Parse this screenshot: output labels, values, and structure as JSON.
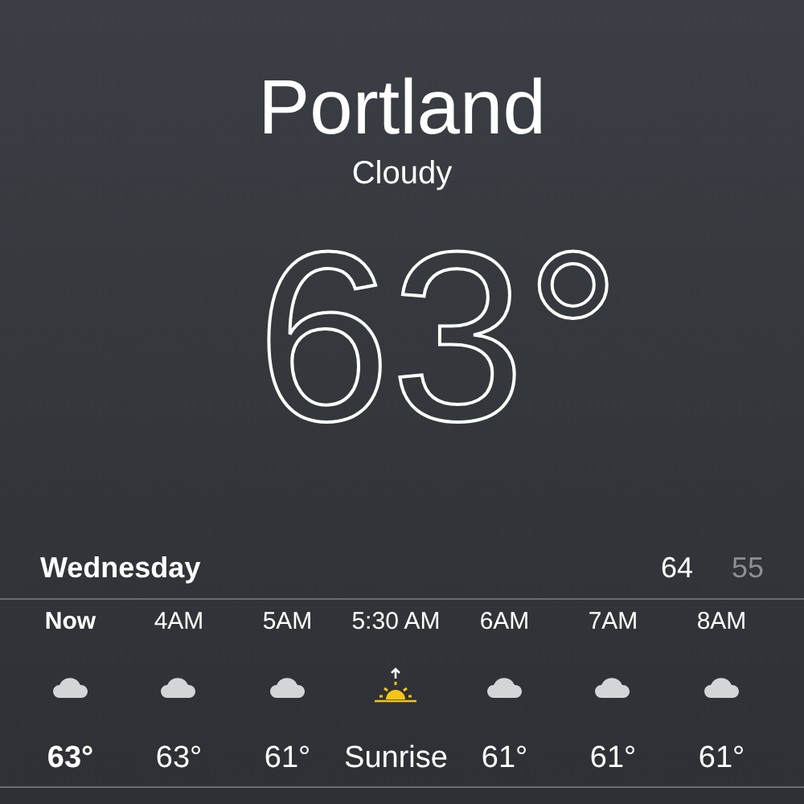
{
  "location": {
    "city": "Portland",
    "condition": "Cloudy",
    "temperature": "63°"
  },
  "today": {
    "day": "Wednesday",
    "high": "64",
    "low": "55"
  },
  "hourly": [
    {
      "time": "Now",
      "kind": "cloud",
      "value": "63°",
      "current": true
    },
    {
      "time": "4AM",
      "kind": "cloud",
      "value": "63°",
      "current": false
    },
    {
      "time": "5AM",
      "kind": "cloud",
      "value": "61°",
      "current": false
    },
    {
      "time": "5:30 AM",
      "kind": "sunrise",
      "value": "Sunrise",
      "current": false
    },
    {
      "time": "6AM",
      "kind": "cloud",
      "value": "61°",
      "current": false
    },
    {
      "time": "7AM",
      "kind": "cloud",
      "value": "61°",
      "current": false
    },
    {
      "time": "8AM",
      "kind": "cloud",
      "value": "61°",
      "current": false
    }
  ]
}
